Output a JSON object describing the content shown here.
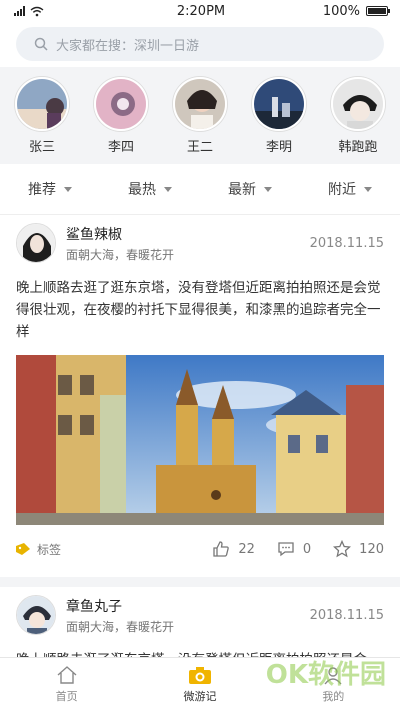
{
  "status": {
    "time": "2:20PM",
    "battery": "100%",
    "battery_level": 1.0
  },
  "search": {
    "placeholder": "大家都在搜：深圳一日游"
  },
  "stories": [
    {
      "name": "张三"
    },
    {
      "name": "李四"
    },
    {
      "name": "王二"
    },
    {
      "name": "李明"
    },
    {
      "name": "韩跑跑"
    }
  ],
  "filters": [
    "推荐",
    "最热",
    "最新",
    "附近"
  ],
  "posts": [
    {
      "name": "鲨鱼辣椒",
      "subtitle": "面朝大海，春暖花开",
      "date": "2018.11.15",
      "text": "晚上顺路去逛了逛东京塔，没有登塔但近距离拍拍照还是会觉得很壮观，在夜樱的衬托下显得很美，和漆黑的追踪者完全一样",
      "tag": "标签",
      "likes": "22",
      "comments": "0",
      "stars": "120"
    },
    {
      "name": "章鱼丸子",
      "subtitle": "面朝大海，春暖花开",
      "date": "2018.11.15",
      "text": "晚上顺路去逛了逛东京塔，没有登塔但近距离拍拍照还是会"
    }
  ],
  "tabbar": [
    "首页",
    "微游记",
    "我的"
  ],
  "watermark": "OK软件园",
  "colors": {
    "accent": "#f0b400",
    "tag_icon": "#e8b400",
    "background_alt": "#f3f4f6"
  }
}
